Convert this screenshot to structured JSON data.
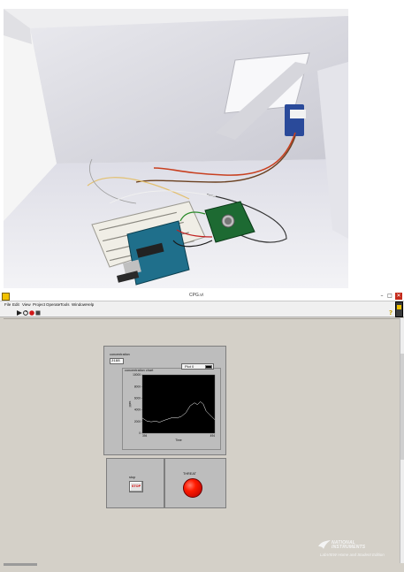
{
  "window": {
    "title": "CPG.vi",
    "minimize": "–",
    "maximize": "□",
    "close": "✕",
    "icon": "labview-app-icon"
  },
  "menu": [
    "File",
    "Edit",
    "View",
    "Project",
    "Operate",
    "Tools",
    "Window",
    "Help"
  ],
  "toolbar": {
    "icons": [
      "run-arrow-icon",
      "run-continuous-icon",
      "abort-icon",
      "pause-icon"
    ],
    "help": "?"
  },
  "front_panel": {
    "concentration_label": "concentration",
    "concentration_value": "2188",
    "chart_label": "concentration chart",
    "legend_label": "Plot 0",
    "stop_label": "stop",
    "stop_button": "STOP",
    "threat_label": "THREAT",
    "threat_led_color": "#ff1a00"
  },
  "branding": {
    "line1": "NATIONAL",
    "line2": "INSTRUMENTS",
    "line3": "LabVIEW Home and Student Edition"
  },
  "chart_data": {
    "type": "line",
    "xlabel": "Time",
    "ylabel": "ppm",
    "x_ticks": [
      "394",
      "494"
    ],
    "y_ticks": [
      "0",
      "2000",
      "4000",
      "6000",
      "8000",
      "10000"
    ],
    "xlim": [
      394,
      494
    ],
    "ylim": [
      0,
      10000
    ],
    "series": [
      {
        "name": "Plot 0",
        "color": "#ffffff",
        "x": [
          394,
          400,
          406,
          412,
          418,
          424,
          430,
          436,
          442,
          448,
          454,
          460,
          466,
          470,
          474,
          478,
          482,
          486,
          490,
          494
        ],
        "y": [
          2600,
          2100,
          1950,
          2050,
          1900,
          2200,
          2450,
          2700,
          2600,
          2900,
          3500,
          4700,
          5200,
          4900,
          5400,
          5000,
          3800,
          3300,
          2800,
          2300
        ]
      }
    ]
  }
}
